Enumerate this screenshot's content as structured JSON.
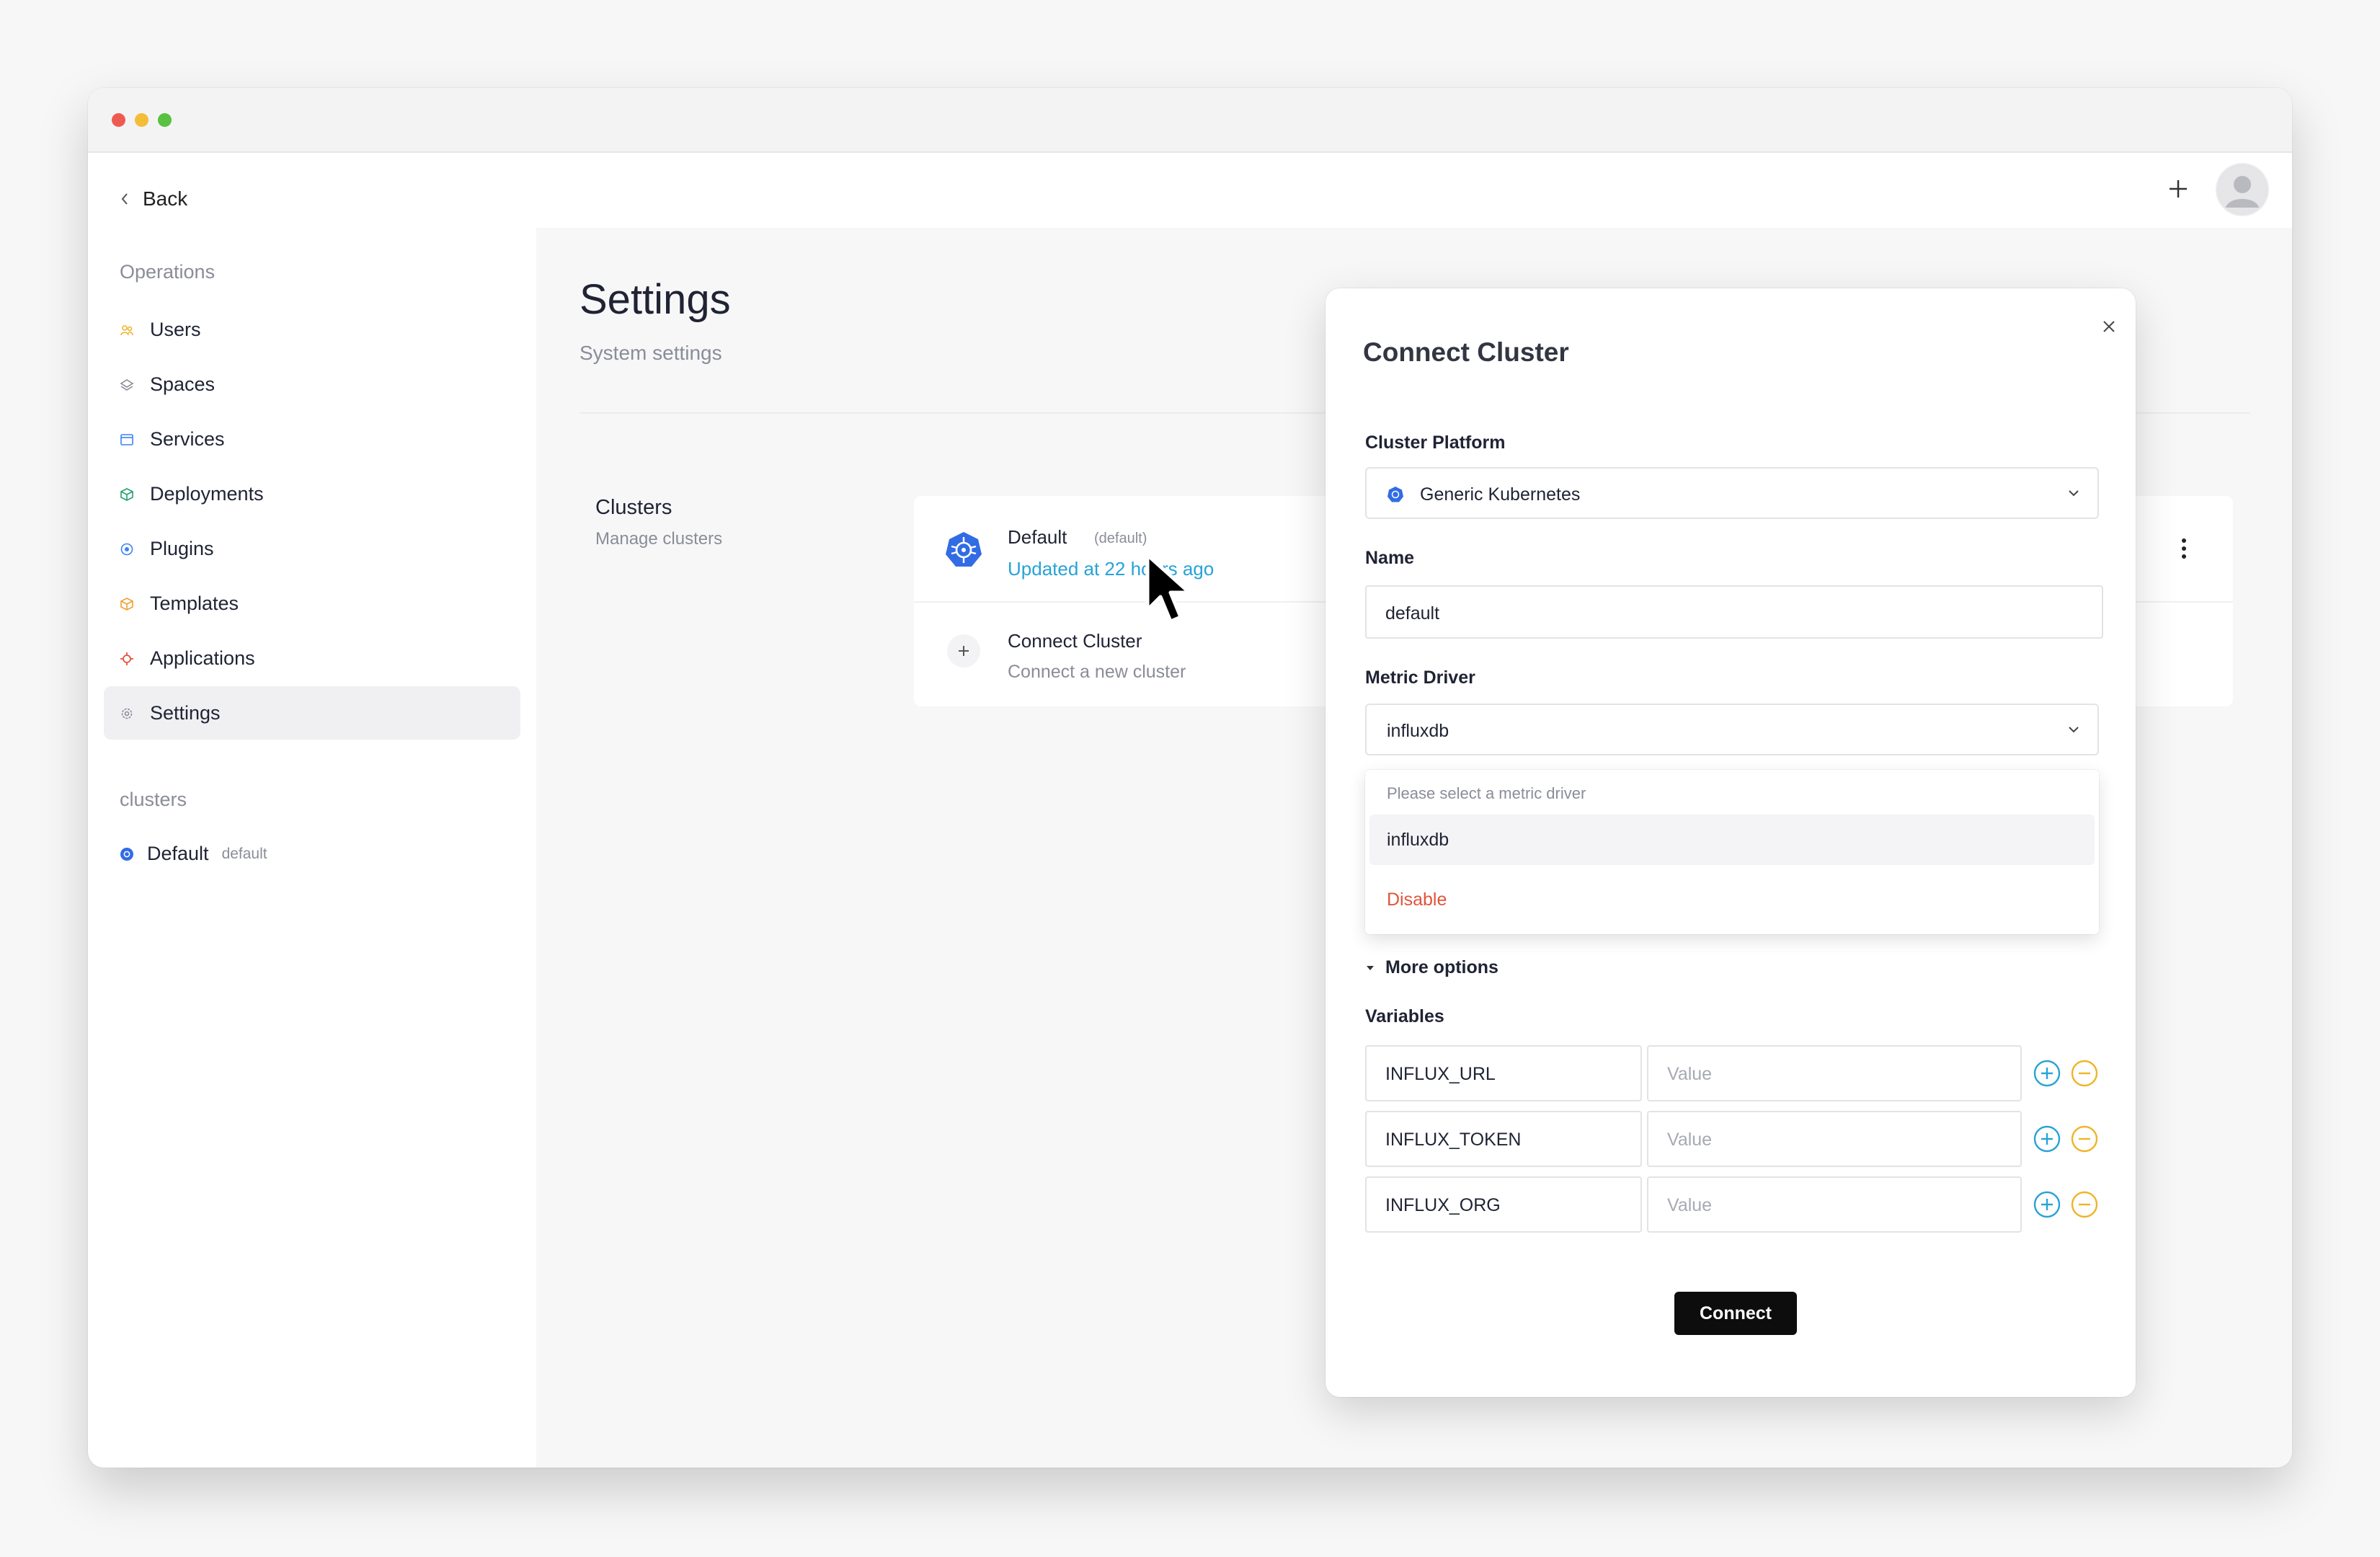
{
  "sidebar": {
    "back_label": "Back",
    "operations_label": "Operations",
    "items": [
      {
        "label": "Users",
        "icon": "users-icon",
        "color": "#f0b429"
      },
      {
        "label": "Spaces",
        "icon": "layers-icon",
        "color": "#8a8d98"
      },
      {
        "label": "Services",
        "icon": "window-icon",
        "color": "#3b82f6"
      },
      {
        "label": "Deployments",
        "icon": "cube-icon",
        "color": "#22a06b"
      },
      {
        "label": "Plugins",
        "icon": "plugin-icon",
        "color": "#3b82f6"
      },
      {
        "label": "Templates",
        "icon": "box-icon",
        "color": "#f0a030"
      },
      {
        "label": "Applications",
        "icon": "app-icon",
        "color": "#e2543b"
      },
      {
        "label": "Settings",
        "icon": "gear-icon",
        "color": "#8a8d98",
        "active": true
      }
    ],
    "clusters_label": "clusters",
    "cluster_item": {
      "name": "Default",
      "tag": "default"
    }
  },
  "page": {
    "title": "Settings",
    "subtitle": "System settings"
  },
  "clusters": {
    "title": "Clusters",
    "subtitle": "Manage clusters",
    "default_name": "Default",
    "default_tag": "(default)",
    "default_updated": "Updated at 22 hours ago",
    "connect_title": "Connect Cluster",
    "connect_subtitle": "Connect a new cluster"
  },
  "modal": {
    "title": "Connect Cluster",
    "platform_label": "Cluster Platform",
    "platform_value": "Generic Kubernetes",
    "name_label": "Name",
    "name_value": "default",
    "metric_label": "Metric Driver",
    "metric_value": "influxdb",
    "dropdown": {
      "header": "Please select a metric driver",
      "options": [
        "influxdb"
      ],
      "disable_label": "Disable"
    },
    "more_options_label": "More options",
    "variables_label": "Variables",
    "variables": [
      {
        "key": "INFLUX_URL",
        "value_placeholder": "Value"
      },
      {
        "key": "INFLUX_TOKEN",
        "value_placeholder": "Value"
      },
      {
        "key": "INFLUX_ORG",
        "value_placeholder": "Value"
      }
    ],
    "connect_label": "Connect"
  },
  "colors": {
    "accent_blue": "#27a3d6",
    "kubernetes_blue": "#326ce5",
    "danger": "#e2543b",
    "remove_yellow": "#f0b429",
    "add_blue": "#27a3d6"
  }
}
